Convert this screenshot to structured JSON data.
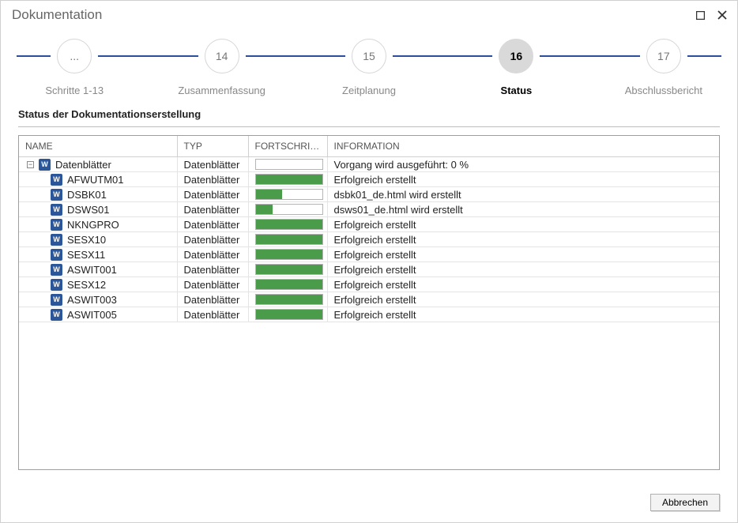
{
  "window": {
    "title": "Dokumentation"
  },
  "wizard": {
    "steps": [
      {
        "num": "...",
        "label": "Schritte 1-13",
        "active": false
      },
      {
        "num": "14",
        "label": "Zusammenfassung",
        "active": false
      },
      {
        "num": "15",
        "label": "Zeitplanung",
        "active": false
      },
      {
        "num": "16",
        "label": "Status",
        "active": true
      },
      {
        "num": "17",
        "label": "Abschlussbericht",
        "active": false
      }
    ]
  },
  "section": {
    "title": "Status der Dokumentationserstellung"
  },
  "columns": {
    "name": "NAME",
    "type": "TYP",
    "progress": "FORTSCHRITT IN...",
    "information": "INFORMATION"
  },
  "rows": [
    {
      "indent": 0,
      "expand": true,
      "name": "Datenblätter",
      "type": "Datenblätter",
      "progress": 0,
      "info": "Vorgang wird ausgeführt: 0 %"
    },
    {
      "indent": 1,
      "expand": false,
      "name": "AFWUTM01",
      "type": "Datenblätter",
      "progress": 100,
      "info": "Erfolgreich erstellt"
    },
    {
      "indent": 1,
      "expand": false,
      "name": "DSBK01",
      "type": "Datenblätter",
      "progress": 40,
      "info": "dsbk01_de.html wird erstellt"
    },
    {
      "indent": 1,
      "expand": false,
      "name": "DSWS01",
      "type": "Datenblätter",
      "progress": 25,
      "info": "dsws01_de.html wird erstellt"
    },
    {
      "indent": 1,
      "expand": false,
      "name": "NKNGPRO",
      "type": "Datenblätter",
      "progress": 100,
      "info": "Erfolgreich erstellt"
    },
    {
      "indent": 1,
      "expand": false,
      "name": "SESX10",
      "type": "Datenblätter",
      "progress": 100,
      "info": "Erfolgreich erstellt"
    },
    {
      "indent": 1,
      "expand": false,
      "name": "SESX11",
      "type": "Datenblätter",
      "progress": 100,
      "info": "Erfolgreich erstellt"
    },
    {
      "indent": 1,
      "expand": false,
      "name": "ASWIT001",
      "type": "Datenblätter",
      "progress": 100,
      "info": "Erfolgreich erstellt"
    },
    {
      "indent": 1,
      "expand": false,
      "name": "SESX12",
      "type": "Datenblätter",
      "progress": 100,
      "info": "Erfolgreich erstellt"
    },
    {
      "indent": 1,
      "expand": false,
      "name": "ASWIT003",
      "type": "Datenblätter",
      "progress": 100,
      "info": "Erfolgreich erstellt"
    },
    {
      "indent": 1,
      "expand": false,
      "name": "ASWIT005",
      "type": "Datenblätter",
      "progress": 100,
      "info": "Erfolgreich erstellt"
    }
  ],
  "footer": {
    "cancel": "Abbrechen"
  }
}
